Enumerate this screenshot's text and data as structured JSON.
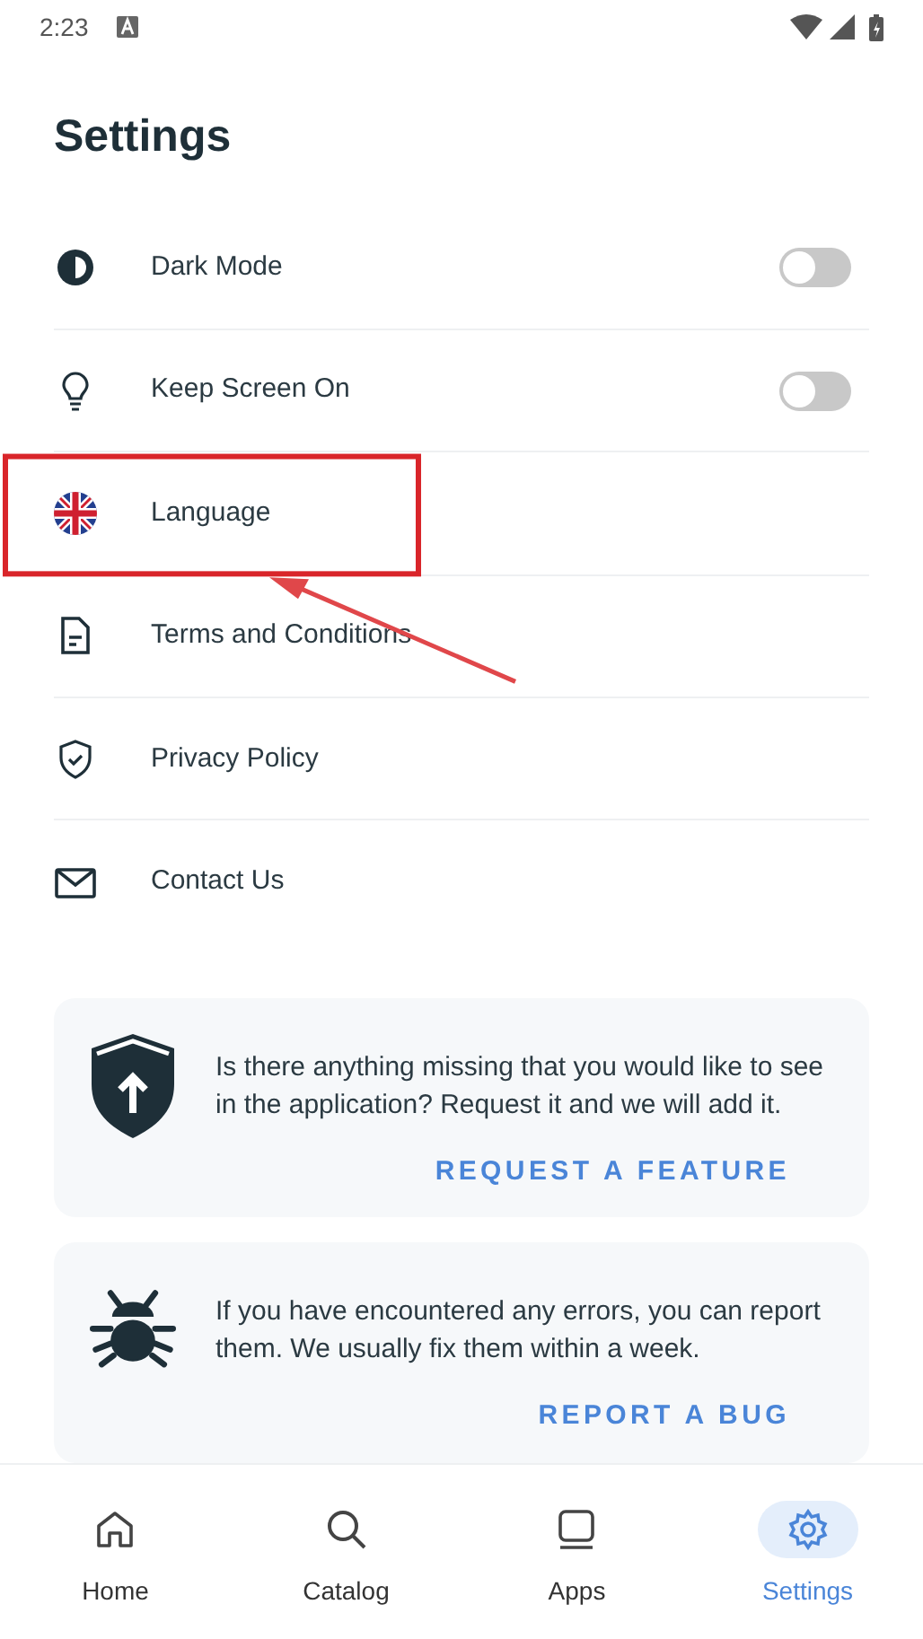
{
  "status_bar": {
    "time": "2:23"
  },
  "title": "Settings",
  "items": [
    {
      "kind": "toggle",
      "label": "Dark Mode",
      "on": false,
      "highlighted": false
    },
    {
      "kind": "toggle",
      "label": "Keep Screen On",
      "on": false,
      "highlighted": false
    },
    {
      "kind": "link",
      "label": "Language",
      "highlighted": true
    },
    {
      "kind": "link",
      "label": "Terms and Conditions",
      "highlighted": false
    },
    {
      "kind": "link",
      "label": "Privacy Policy",
      "highlighted": false
    },
    {
      "kind": "link",
      "label": "Contact Us",
      "highlighted": false
    }
  ],
  "cards": [
    {
      "text": "Is there anything missing that you would like to see in the application? Request it and we will add it.",
      "action": "REQUEST A FEATURE"
    },
    {
      "text": "If you have encountered any errors, you can report them. We usually fix them within a week.",
      "action": "REPORT A BUG"
    }
  ],
  "nav": [
    {
      "label": "Home",
      "selected": false
    },
    {
      "label": "Catalog",
      "selected": false
    },
    {
      "label": "Apps",
      "selected": false
    },
    {
      "label": "Settings",
      "selected": true
    }
  ]
}
